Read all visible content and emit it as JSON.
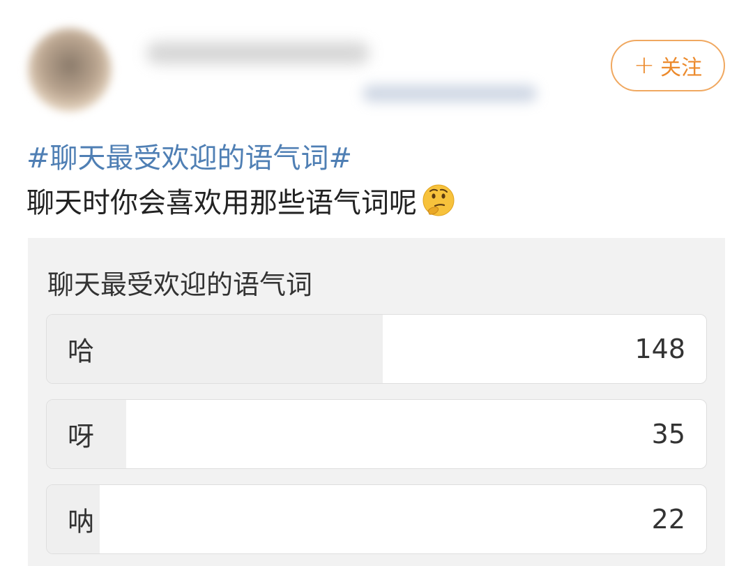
{
  "header": {
    "follow_label": "关注",
    "follow_icon": "plus-icon"
  },
  "post": {
    "hashtag": "#聊天最受欢迎的语气词#",
    "text": "聊天时你会喜欢用那些语气词呢",
    "emoji": "thinking-face-icon"
  },
  "poll": {
    "title": "聊天最受欢迎的语气词",
    "options": [
      {
        "label": "哈",
        "count": "148",
        "fill_percent": 51
      },
      {
        "label": "呀",
        "count": "35",
        "fill_percent": 12
      },
      {
        "label": "呐",
        "count": "22",
        "fill_percent": 8
      }
    ]
  },
  "colors": {
    "accent": "#ec8a2c",
    "hashtag": "#4f7fb4",
    "card_bg": "#f2f2f2"
  }
}
